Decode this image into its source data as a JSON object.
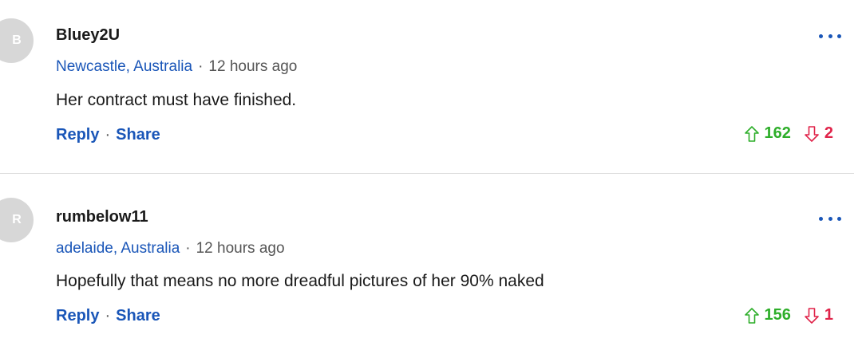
{
  "comments": [
    {
      "avatar_letter": "B",
      "username": "Bluey2U",
      "location": "Newcastle, Australia",
      "separator": "·",
      "time": "12 hours ago",
      "text": "Her contract must have finished.",
      "reply_label": "Reply",
      "share_label": "Share",
      "upvotes": "162",
      "downvotes": "2"
    },
    {
      "avatar_letter": "R",
      "username": "rumbelow11",
      "location": "adelaide, Australia",
      "separator": "·",
      "time": "12 hours ago",
      "text": "Hopefully that means no more dreadful pictures of her 90% naked",
      "reply_label": "Reply",
      "share_label": "Share",
      "upvotes": "156",
      "downvotes": "1"
    }
  ],
  "icons": {
    "more": "more-dots-icon",
    "upvote": "arrow-up-icon",
    "downvote": "arrow-down-icon"
  },
  "colors": {
    "link": "#1a56b8",
    "upvote": "#2eae2a",
    "downvote": "#e0244a",
    "avatar_bg": "#d7d7d7"
  }
}
